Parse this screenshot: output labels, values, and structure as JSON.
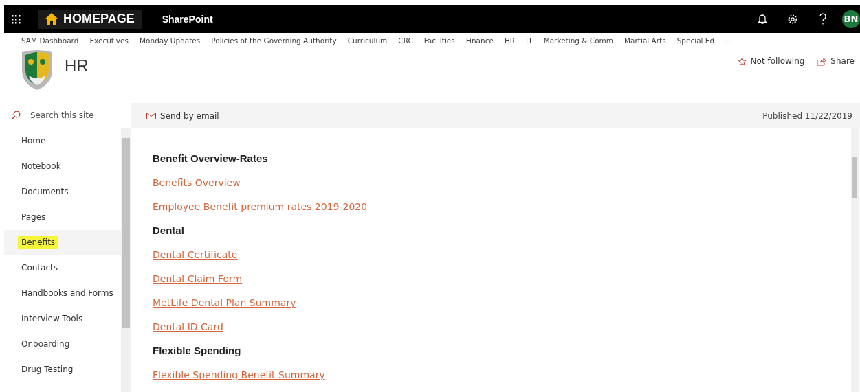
{
  "suite_bar": {
    "brand": "HOMEPAGE",
    "app_name": "SharePoint",
    "avatar": "BN"
  },
  "hub_nav": [
    "SAM Dashboard",
    "Executives",
    "Monday Updates",
    "Policies of the Governing Authority",
    "Curriculum",
    "CRC",
    "Facilities",
    "Finance",
    "HR",
    "IT",
    "Marketing & Comm",
    "Martial Arts",
    "Special Ed",
    "···"
  ],
  "site": {
    "title": "HR",
    "follow": "Not following",
    "share": "Share"
  },
  "search": {
    "placeholder": "Search this site"
  },
  "command_bar": {
    "action": "Send by email",
    "published": "Published 11/22/2019"
  },
  "sidebar": {
    "items": [
      {
        "label": "Home",
        "selected": false
      },
      {
        "label": "Notebook",
        "selected": false
      },
      {
        "label": "Documents",
        "selected": false
      },
      {
        "label": "Pages",
        "selected": false
      },
      {
        "label": "Benefits",
        "selected": true
      },
      {
        "label": "Contacts",
        "selected": false
      },
      {
        "label": "Handbooks and Forms",
        "selected": false
      },
      {
        "label": "Interview Tools",
        "selected": false
      },
      {
        "label": "Onboarding",
        "selected": false
      },
      {
        "label": "Drug Testing",
        "selected": false
      }
    ]
  },
  "content": [
    {
      "kind": "heading",
      "text": "Benefit Overview-Rates"
    },
    {
      "kind": "link",
      "text": "Benefits Overview"
    },
    {
      "kind": "link",
      "text": "Employee Benefit premium rates 2019-2020"
    },
    {
      "kind": "heading",
      "text": "Dental"
    },
    {
      "kind": "link",
      "text": "Dental Certificate"
    },
    {
      "kind": "link",
      "text": "Dental Claim Form"
    },
    {
      "kind": "link",
      "text": "MetLife Dental Plan Summary"
    },
    {
      "kind": "link",
      "text": "Dental ID Card"
    },
    {
      "kind": "heading",
      "text": "Flexible Spending"
    },
    {
      "kind": "link",
      "text": "Flexible Spending Benefit Summary"
    }
  ]
}
